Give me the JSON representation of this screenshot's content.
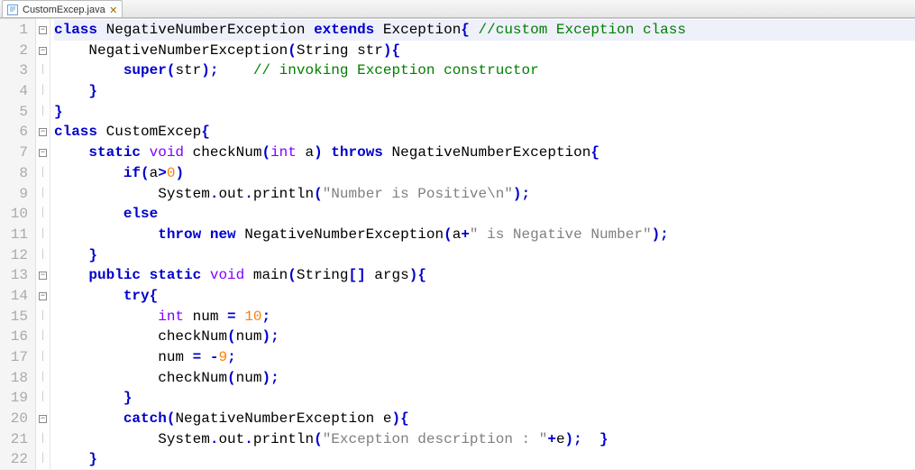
{
  "tab": {
    "filename": "CustomExcep.java",
    "icon": "java-file-icon",
    "active": true,
    "close_glyph": "✕"
  },
  "gutter": {
    "start": 1,
    "end": 22
  },
  "fold_marks": {
    "1": "minus",
    "2": "minus",
    "6": "minus",
    "7": "minus",
    "13": "minus",
    "14": "minus",
    "20": "minus"
  },
  "code": {
    "lines": [
      [
        {
          "c": "kw",
          "t": "class"
        },
        {
          "c": "plain",
          "t": " NegativeNumberException "
        },
        {
          "c": "kw",
          "t": "extends"
        },
        {
          "c": "plain",
          "t": " Exception"
        },
        {
          "c": "kw",
          "t": "{"
        },
        {
          "c": "plain",
          "t": " "
        },
        {
          "c": "cm",
          "t": "//custom Exception class"
        }
      ],
      [
        {
          "c": "plain",
          "t": "    NegativeNumberException"
        },
        {
          "c": "kw",
          "t": "("
        },
        {
          "c": "plain",
          "t": "String str"
        },
        {
          "c": "kw",
          "t": ")"
        },
        {
          "c": "kw",
          "t": "{"
        }
      ],
      [
        {
          "c": "plain",
          "t": "        "
        },
        {
          "c": "kw",
          "t": "super"
        },
        {
          "c": "kw",
          "t": "("
        },
        {
          "c": "plain",
          "t": "str"
        },
        {
          "c": "kw",
          "t": ")"
        },
        {
          "c": "kw",
          "t": ";"
        },
        {
          "c": "plain",
          "t": "    "
        },
        {
          "c": "cm",
          "t": "// invoking Exception constructor"
        }
      ],
      [
        {
          "c": "plain",
          "t": "    "
        },
        {
          "c": "kw",
          "t": "}"
        }
      ],
      [
        {
          "c": "kw",
          "t": "}"
        }
      ],
      [
        {
          "c": "kw",
          "t": "class"
        },
        {
          "c": "plain",
          "t": " CustomExcep"
        },
        {
          "c": "kw",
          "t": "{"
        }
      ],
      [
        {
          "c": "plain",
          "t": "    "
        },
        {
          "c": "kw",
          "t": "static"
        },
        {
          "c": "plain",
          "t": " "
        },
        {
          "c": "tp",
          "t": "void"
        },
        {
          "c": "plain",
          "t": " checkNum"
        },
        {
          "c": "kw",
          "t": "("
        },
        {
          "c": "tp",
          "t": "int"
        },
        {
          "c": "plain",
          "t": " a"
        },
        {
          "c": "kw",
          "t": ")"
        },
        {
          "c": "plain",
          "t": " "
        },
        {
          "c": "kw",
          "t": "throws"
        },
        {
          "c": "plain",
          "t": " NegativeNumberException"
        },
        {
          "c": "kw",
          "t": "{"
        }
      ],
      [
        {
          "c": "plain",
          "t": "        "
        },
        {
          "c": "kw",
          "t": "if"
        },
        {
          "c": "kw",
          "t": "("
        },
        {
          "c": "plain",
          "t": "a"
        },
        {
          "c": "kw",
          "t": ">"
        },
        {
          "c": "num",
          "t": "0"
        },
        {
          "c": "kw",
          "t": ")"
        }
      ],
      [
        {
          "c": "plain",
          "t": "            System"
        },
        {
          "c": "kw",
          "t": "."
        },
        {
          "c": "plain",
          "t": "out"
        },
        {
          "c": "kw",
          "t": "."
        },
        {
          "c": "plain",
          "t": "println"
        },
        {
          "c": "kw",
          "t": "("
        },
        {
          "c": "str",
          "t": "\"Number is Positive\\n\""
        },
        {
          "c": "kw",
          "t": ")"
        },
        {
          "c": "kw",
          "t": ";"
        }
      ],
      [
        {
          "c": "plain",
          "t": "        "
        },
        {
          "c": "kw",
          "t": "else"
        }
      ],
      [
        {
          "c": "plain",
          "t": "            "
        },
        {
          "c": "kw",
          "t": "throw"
        },
        {
          "c": "plain",
          "t": " "
        },
        {
          "c": "kw",
          "t": "new"
        },
        {
          "c": "plain",
          "t": " NegativeNumberException"
        },
        {
          "c": "kw",
          "t": "("
        },
        {
          "c": "plain",
          "t": "a"
        },
        {
          "c": "kw",
          "t": "+"
        },
        {
          "c": "str",
          "t": "\" is Negative Number\""
        },
        {
          "c": "kw",
          "t": ")"
        },
        {
          "c": "kw",
          "t": ";"
        }
      ],
      [
        {
          "c": "plain",
          "t": "    "
        },
        {
          "c": "kw",
          "t": "}"
        }
      ],
      [
        {
          "c": "plain",
          "t": "    "
        },
        {
          "c": "kw",
          "t": "public"
        },
        {
          "c": "plain",
          "t": " "
        },
        {
          "c": "kw",
          "t": "static"
        },
        {
          "c": "plain",
          "t": " "
        },
        {
          "c": "tp",
          "t": "void"
        },
        {
          "c": "plain",
          "t": " main"
        },
        {
          "c": "kw",
          "t": "("
        },
        {
          "c": "plain",
          "t": "String"
        },
        {
          "c": "kw",
          "t": "[]"
        },
        {
          "c": "plain",
          "t": " args"
        },
        {
          "c": "kw",
          "t": ")"
        },
        {
          "c": "kw",
          "t": "{"
        }
      ],
      [
        {
          "c": "plain",
          "t": "        "
        },
        {
          "c": "kw",
          "t": "try"
        },
        {
          "c": "kw",
          "t": "{"
        }
      ],
      [
        {
          "c": "plain",
          "t": "            "
        },
        {
          "c": "tp",
          "t": "int"
        },
        {
          "c": "plain",
          "t": " num "
        },
        {
          "c": "kw",
          "t": "="
        },
        {
          "c": "plain",
          "t": " "
        },
        {
          "c": "num",
          "t": "10"
        },
        {
          "c": "kw",
          "t": ";"
        }
      ],
      [
        {
          "c": "plain",
          "t": "            checkNum"
        },
        {
          "c": "kw",
          "t": "("
        },
        {
          "c": "plain",
          "t": "num"
        },
        {
          "c": "kw",
          "t": ")"
        },
        {
          "c": "kw",
          "t": ";"
        }
      ],
      [
        {
          "c": "plain",
          "t": "            num "
        },
        {
          "c": "kw",
          "t": "="
        },
        {
          "c": "plain",
          "t": " "
        },
        {
          "c": "kw",
          "t": "-"
        },
        {
          "c": "num",
          "t": "9"
        },
        {
          "c": "kw",
          "t": ";"
        }
      ],
      [
        {
          "c": "plain",
          "t": "            checkNum"
        },
        {
          "c": "kw",
          "t": "("
        },
        {
          "c": "plain",
          "t": "num"
        },
        {
          "c": "kw",
          "t": ")"
        },
        {
          "c": "kw",
          "t": ";"
        }
      ],
      [
        {
          "c": "plain",
          "t": "        "
        },
        {
          "c": "kw",
          "t": "}"
        }
      ],
      [
        {
          "c": "plain",
          "t": "        "
        },
        {
          "c": "kw",
          "t": "catch"
        },
        {
          "c": "kw",
          "t": "("
        },
        {
          "c": "plain",
          "t": "NegativeNumberException e"
        },
        {
          "c": "kw",
          "t": ")"
        },
        {
          "c": "kw",
          "t": "{"
        }
      ],
      [
        {
          "c": "plain",
          "t": "            System"
        },
        {
          "c": "kw",
          "t": "."
        },
        {
          "c": "plain",
          "t": "out"
        },
        {
          "c": "kw",
          "t": "."
        },
        {
          "c": "plain",
          "t": "println"
        },
        {
          "c": "kw",
          "t": "("
        },
        {
          "c": "str",
          "t": "\"Exception description : \""
        },
        {
          "c": "kw",
          "t": "+"
        },
        {
          "c": "plain",
          "t": "e"
        },
        {
          "c": "kw",
          "t": ")"
        },
        {
          "c": "kw",
          "t": ";"
        },
        {
          "c": "plain",
          "t": "  "
        },
        {
          "c": "kw",
          "t": "}"
        }
      ],
      [
        {
          "c": "plain",
          "t": "    "
        },
        {
          "c": "kw",
          "t": "}"
        }
      ]
    ],
    "highlight_line": 1
  }
}
